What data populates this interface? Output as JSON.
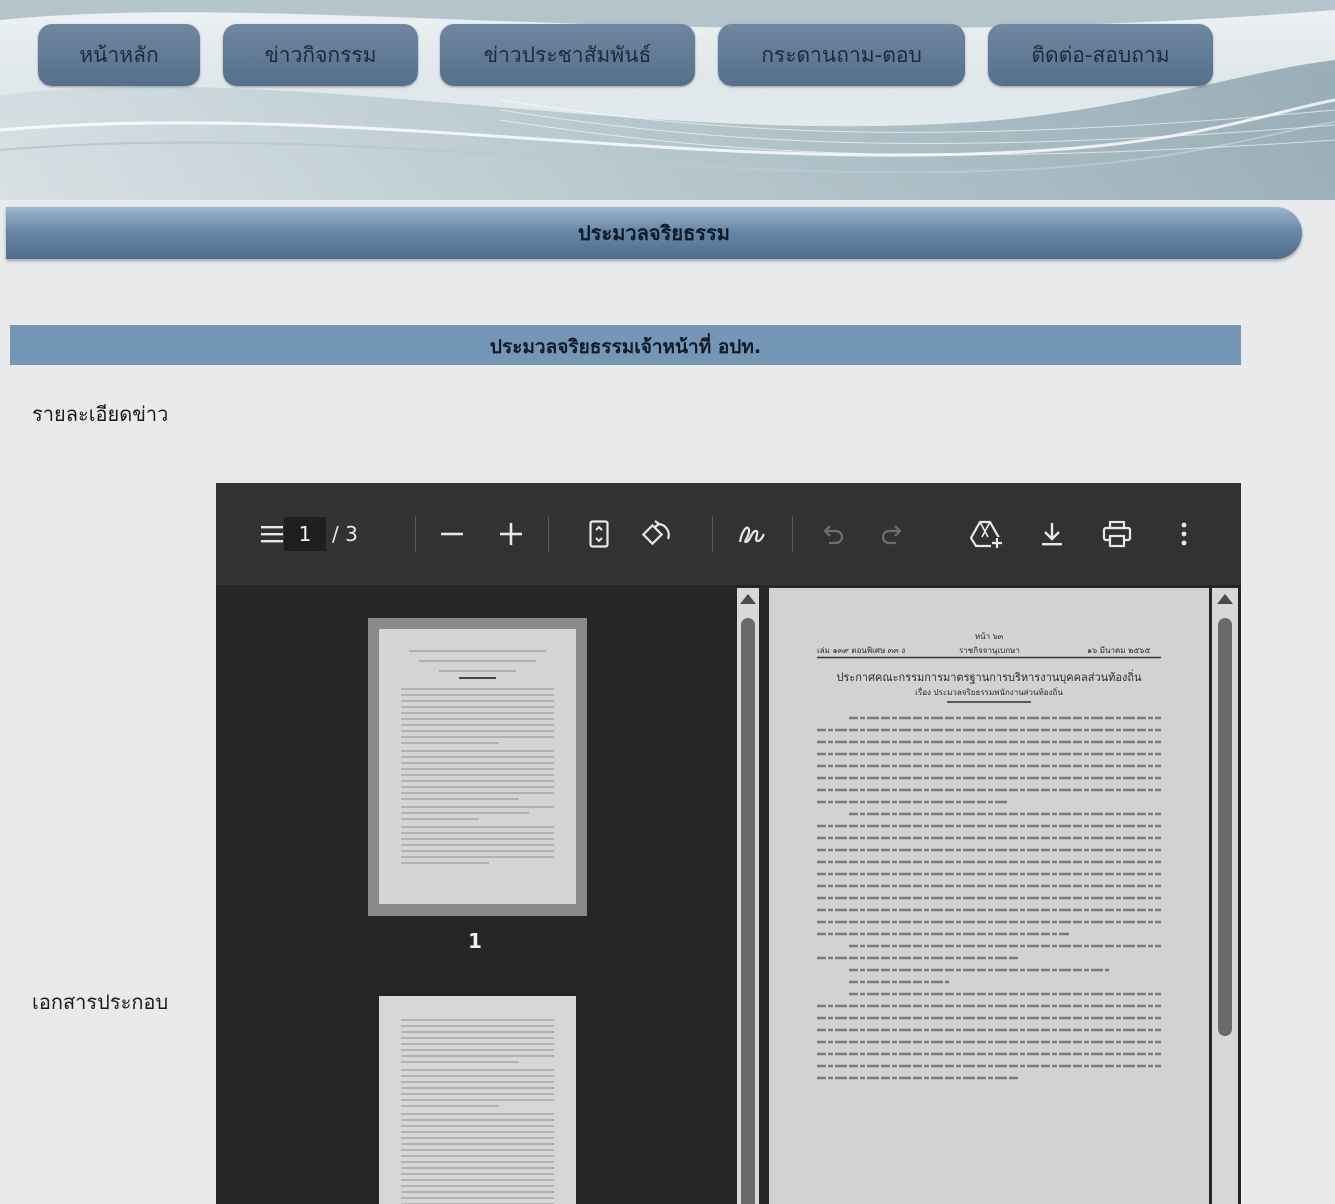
{
  "nav": {
    "items": [
      {
        "label": "หน้าหลัก"
      },
      {
        "label": "ข่าวกิจกรรม"
      },
      {
        "label": "ข่าวประชาสัมพันธ์"
      },
      {
        "label": "กระดานถาม-ตอบ"
      },
      {
        "label": "ติดต่อ-สอบถาม"
      }
    ]
  },
  "section_title": "ประมวลจริยธรรม",
  "article_title": "ประมวลจริยธรรมเจ้าหน้าที่ อปท.",
  "labels": {
    "detail": "รายละเอียดข่าว",
    "attachment": "เอกสารประกอบ"
  },
  "pdf_viewer": {
    "current_page": "1",
    "page_count": "/ 3",
    "thumbnail_page_label": "1",
    "icons": [
      "menu-icon",
      "zoom-out-icon",
      "zoom-in-icon",
      "fit-page-icon",
      "rotate-icon",
      "draw-icon",
      "undo-icon",
      "redo-icon",
      "add-to-drive-icon",
      "download-icon",
      "print-icon",
      "more-icon"
    ],
    "document": {
      "header_line1": "หน้า ๖๓",
      "header_left": "เล่ม ๑๓๙ ตอนพิเศษ ๓๓ ง",
      "header_center": "ราชกิจจานุเบกษา",
      "header_right": "๑๖ มีนาคม ๒๕๖๕",
      "title": "ประกาศคณะกรรมการมาตรฐานการบริหารงานบุคคลส่วนท้องถิ่น",
      "subtitle": "เรื่อง ประมวลจริยธรรมพนักงานส่วนท้องถิ่น"
    }
  }
}
